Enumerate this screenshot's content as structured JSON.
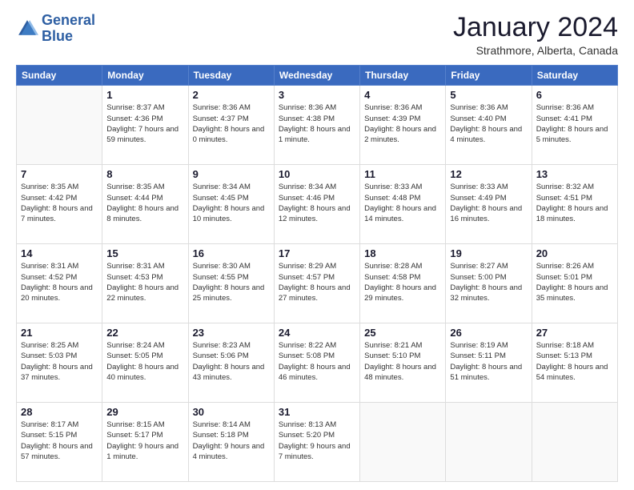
{
  "header": {
    "logo_line1": "General",
    "logo_line2": "Blue",
    "title": "January 2024",
    "location": "Strathmore, Alberta, Canada"
  },
  "weekdays": [
    "Sunday",
    "Monday",
    "Tuesday",
    "Wednesday",
    "Thursday",
    "Friday",
    "Saturday"
  ],
  "weeks": [
    [
      {
        "day": "",
        "details": ""
      },
      {
        "day": "1",
        "details": "Sunrise: 8:37 AM\nSunset: 4:36 PM\nDaylight: 7 hours\nand 59 minutes."
      },
      {
        "day": "2",
        "details": "Sunrise: 8:36 AM\nSunset: 4:37 PM\nDaylight: 8 hours\nand 0 minutes."
      },
      {
        "day": "3",
        "details": "Sunrise: 8:36 AM\nSunset: 4:38 PM\nDaylight: 8 hours\nand 1 minute."
      },
      {
        "day": "4",
        "details": "Sunrise: 8:36 AM\nSunset: 4:39 PM\nDaylight: 8 hours\nand 2 minutes."
      },
      {
        "day": "5",
        "details": "Sunrise: 8:36 AM\nSunset: 4:40 PM\nDaylight: 8 hours\nand 4 minutes."
      },
      {
        "day": "6",
        "details": "Sunrise: 8:36 AM\nSunset: 4:41 PM\nDaylight: 8 hours\nand 5 minutes."
      }
    ],
    [
      {
        "day": "7",
        "details": "Sunrise: 8:35 AM\nSunset: 4:42 PM\nDaylight: 8 hours\nand 7 minutes."
      },
      {
        "day": "8",
        "details": "Sunrise: 8:35 AM\nSunset: 4:44 PM\nDaylight: 8 hours\nand 8 minutes."
      },
      {
        "day": "9",
        "details": "Sunrise: 8:34 AM\nSunset: 4:45 PM\nDaylight: 8 hours\nand 10 minutes."
      },
      {
        "day": "10",
        "details": "Sunrise: 8:34 AM\nSunset: 4:46 PM\nDaylight: 8 hours\nand 12 minutes."
      },
      {
        "day": "11",
        "details": "Sunrise: 8:33 AM\nSunset: 4:48 PM\nDaylight: 8 hours\nand 14 minutes."
      },
      {
        "day": "12",
        "details": "Sunrise: 8:33 AM\nSunset: 4:49 PM\nDaylight: 8 hours\nand 16 minutes."
      },
      {
        "day": "13",
        "details": "Sunrise: 8:32 AM\nSunset: 4:51 PM\nDaylight: 8 hours\nand 18 minutes."
      }
    ],
    [
      {
        "day": "14",
        "details": "Sunrise: 8:31 AM\nSunset: 4:52 PM\nDaylight: 8 hours\nand 20 minutes."
      },
      {
        "day": "15",
        "details": "Sunrise: 8:31 AM\nSunset: 4:53 PM\nDaylight: 8 hours\nand 22 minutes."
      },
      {
        "day": "16",
        "details": "Sunrise: 8:30 AM\nSunset: 4:55 PM\nDaylight: 8 hours\nand 25 minutes."
      },
      {
        "day": "17",
        "details": "Sunrise: 8:29 AM\nSunset: 4:57 PM\nDaylight: 8 hours\nand 27 minutes."
      },
      {
        "day": "18",
        "details": "Sunrise: 8:28 AM\nSunset: 4:58 PM\nDaylight: 8 hours\nand 29 minutes."
      },
      {
        "day": "19",
        "details": "Sunrise: 8:27 AM\nSunset: 5:00 PM\nDaylight: 8 hours\nand 32 minutes."
      },
      {
        "day": "20",
        "details": "Sunrise: 8:26 AM\nSunset: 5:01 PM\nDaylight: 8 hours\nand 35 minutes."
      }
    ],
    [
      {
        "day": "21",
        "details": "Sunrise: 8:25 AM\nSunset: 5:03 PM\nDaylight: 8 hours\nand 37 minutes."
      },
      {
        "day": "22",
        "details": "Sunrise: 8:24 AM\nSunset: 5:05 PM\nDaylight: 8 hours\nand 40 minutes."
      },
      {
        "day": "23",
        "details": "Sunrise: 8:23 AM\nSunset: 5:06 PM\nDaylight: 8 hours\nand 43 minutes."
      },
      {
        "day": "24",
        "details": "Sunrise: 8:22 AM\nSunset: 5:08 PM\nDaylight: 8 hours\nand 46 minutes."
      },
      {
        "day": "25",
        "details": "Sunrise: 8:21 AM\nSunset: 5:10 PM\nDaylight: 8 hours\nand 48 minutes."
      },
      {
        "day": "26",
        "details": "Sunrise: 8:19 AM\nSunset: 5:11 PM\nDaylight: 8 hours\nand 51 minutes."
      },
      {
        "day": "27",
        "details": "Sunrise: 8:18 AM\nSunset: 5:13 PM\nDaylight: 8 hours\nand 54 minutes."
      }
    ],
    [
      {
        "day": "28",
        "details": "Sunrise: 8:17 AM\nSunset: 5:15 PM\nDaylight: 8 hours\nand 57 minutes."
      },
      {
        "day": "29",
        "details": "Sunrise: 8:15 AM\nSunset: 5:17 PM\nDaylight: 9 hours\nand 1 minute."
      },
      {
        "day": "30",
        "details": "Sunrise: 8:14 AM\nSunset: 5:18 PM\nDaylight: 9 hours\nand 4 minutes."
      },
      {
        "day": "31",
        "details": "Sunrise: 8:13 AM\nSunset: 5:20 PM\nDaylight: 9 hours\nand 7 minutes."
      },
      {
        "day": "",
        "details": ""
      },
      {
        "day": "",
        "details": ""
      },
      {
        "day": "",
        "details": ""
      }
    ]
  ]
}
